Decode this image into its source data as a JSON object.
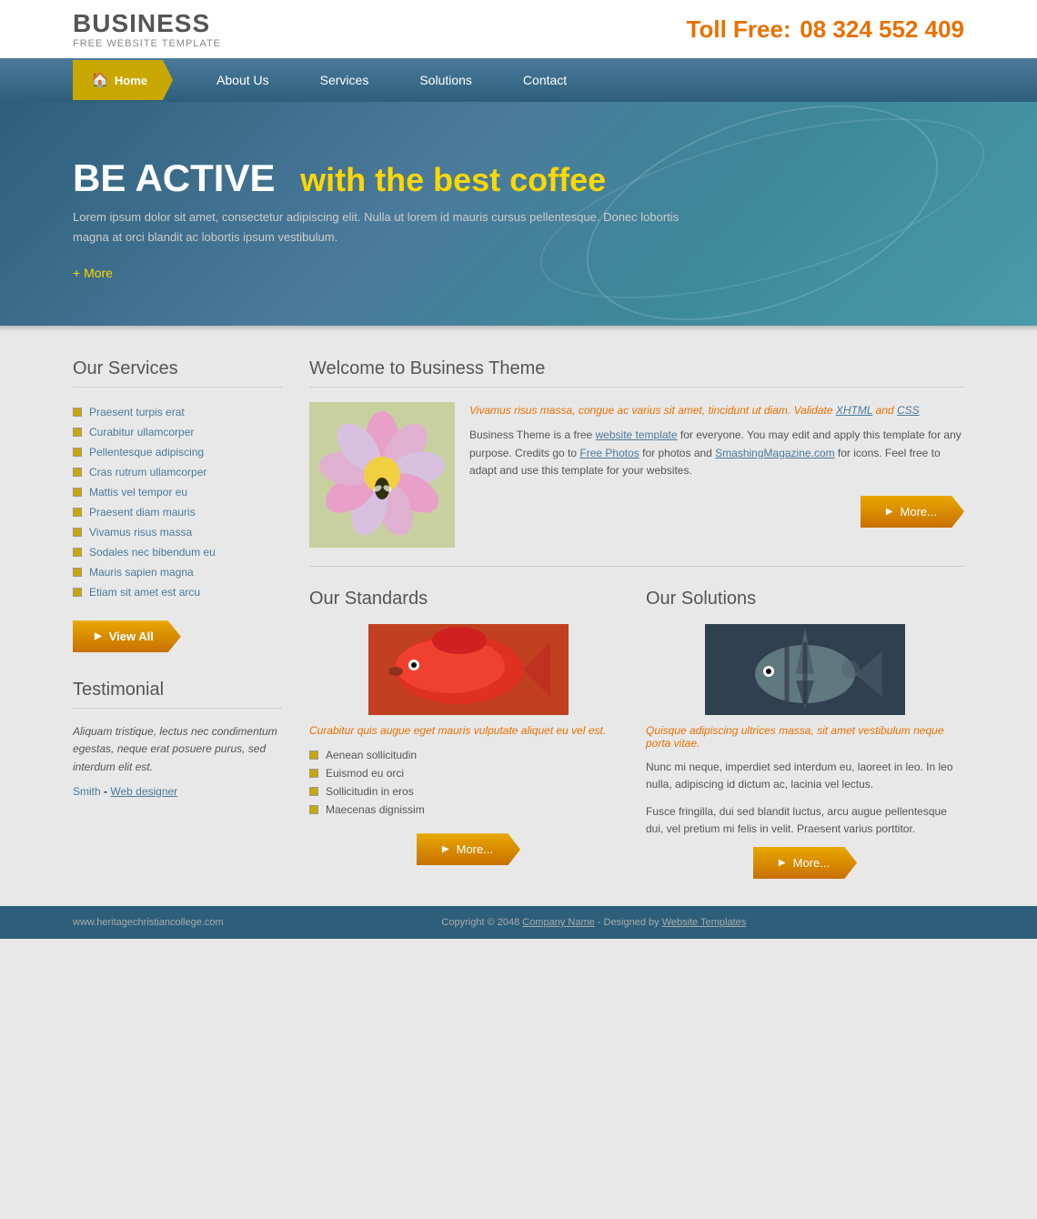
{
  "header": {
    "logo_title": "BUSINESS",
    "logo_subtitle": "FREE WEBSITE TEMPLATE",
    "toll_free_label": "Toll Free:",
    "toll_free_number": "08 324 552 409"
  },
  "nav": {
    "home_label": "Home",
    "about_label": "About Us",
    "services_label": "Services",
    "solutions_label": "Solutions",
    "contact_label": "Contact"
  },
  "banner": {
    "heading_main": "BE ACTIVE",
    "heading_sub": "with the best coffee",
    "description": "Lorem ipsum dolor sit amet, consectetur adipiscing elit. Nulla ut lorem id mauris cursus pellentesque. Donec lobortis magna at orci blandit ac lobortis ipsum vestibulum.",
    "more_text": "+ More"
  },
  "services": {
    "title": "Our Services",
    "items": [
      "Praesent turpis erat",
      "Curabitur ullamcorper",
      "Pellentesque adipiscing",
      "Cras rutrum ullamcorper",
      "Mattis vel tempor eu",
      "Praesent diam mauris",
      "Vivamus risus massa",
      "Sodales nec bibendum eu",
      "Mauris sapien magna",
      "Etiam sit amet est arcu"
    ],
    "view_all_label": "View All"
  },
  "testimonial": {
    "title": "Testimonial",
    "text": "Aliquam tristique, lectus nec condimentum egestas, neque erat posuere purus, sed interdum elit est.",
    "author": "Smith",
    "role": "Web designer"
  },
  "welcome": {
    "title": "Welcome to Business Theme",
    "orange_text": "Vivamus risus massa, congue ac varius sit amet, tincidunt ut diam. Validate XHTML and CSS",
    "body_text": "Business Theme is a free website template for everyone. You may edit and apply this template for any purpose. Credits go to Free Photos for photos and SmashingMagazine.com for icons. Feel free to adapt and use this template for your websites.",
    "more_label": "More..."
  },
  "standards": {
    "title": "Our Standards",
    "italic_text": "Curabitur quis augue eget mauris vulputate aliquet eu vel est.",
    "items": [
      "Aenean sollicitudin",
      "Euismod eu orci",
      "Sollicitudin in eros",
      "Maecenas dignissim"
    ],
    "more_label": "More..."
  },
  "solutions": {
    "title": "Our Solutions",
    "italic_text": "Quisque adipiscing ultrices massa, sit amet vestibulum neque porta vitae.",
    "text1": "Nunc mi neque, imperdiet sed interdum eu, laoreet in leo. In leo nulla, adipiscing id dictum ac, lacinia vel lectus.",
    "text2": "Fusce fringilla, dui sed blandit luctus, arcu augue pellentesque dui, vel pretium mi felis in velit. Praesent varius porttitor.",
    "more_label": "More..."
  },
  "footer": {
    "website": "www.heritagechristiancollege.com",
    "copyright": "Copyright © 2048",
    "company_name": "Company Name",
    "designed_by": "Designed by",
    "templates_link": "Website Templates"
  }
}
